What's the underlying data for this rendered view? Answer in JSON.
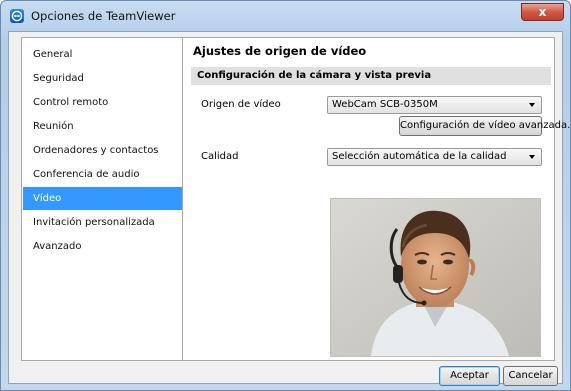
{
  "window": {
    "title": "Opciones de TeamViewer",
    "close_label": "x"
  },
  "sidebar": {
    "items": [
      {
        "label": "General"
      },
      {
        "label": "Seguridad"
      },
      {
        "label": "Control remoto"
      },
      {
        "label": "Reunión"
      },
      {
        "label": "Ordenadores y contactos"
      },
      {
        "label": "Conferencia de audio"
      },
      {
        "label": "Vídeo",
        "selected": true
      },
      {
        "label": "Invitación personalizada"
      },
      {
        "label": "Avanzado"
      }
    ]
  },
  "panel": {
    "title": "Ajustes de origen de vídeo",
    "section": "Configuración de la cámara y vista previa",
    "video_source_label": "Origen de vídeo",
    "video_source_value": "WebCam SCB-0350M",
    "advanced_button": "Configuración de vídeo avanzada...",
    "quality_label": "Calidad",
    "quality_value": "Selección automática de la calidad",
    "preview_icon": "webcam-preview-image"
  },
  "footer": {
    "accept_label": "Aceptar",
    "cancel_label": "Cancelar"
  },
  "colors": {
    "selection": "#3399ff",
    "close_button": "#c9432f"
  }
}
